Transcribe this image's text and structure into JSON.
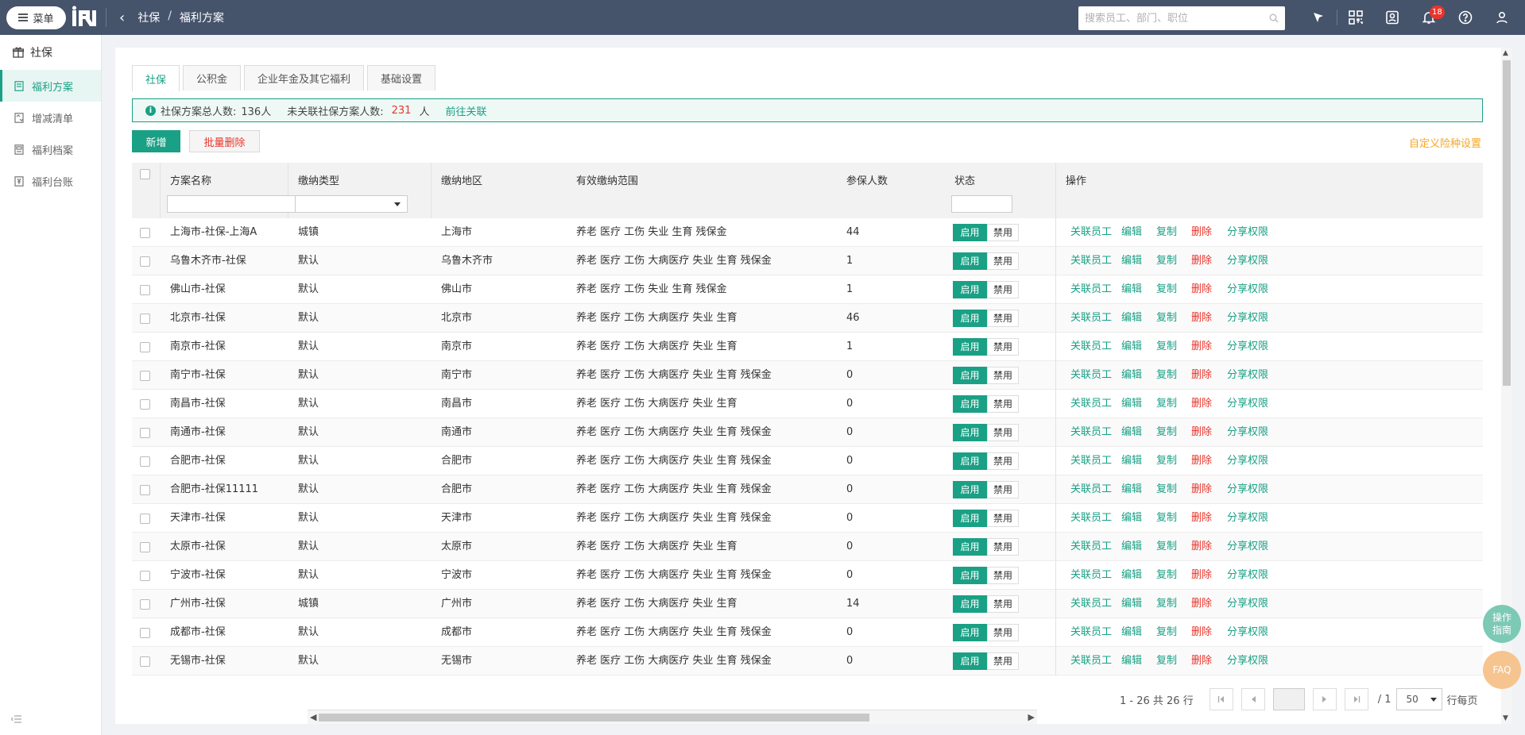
{
  "topbar": {
    "menu_label": "菜单",
    "breadcrumb": [
      "社保",
      "福利方案"
    ],
    "search_placeholder": "搜索员工、部门、职位",
    "notification_count": "18"
  },
  "sidebar": {
    "group": "社保",
    "items": [
      {
        "label": "福利方案",
        "active": true
      },
      {
        "label": "增减清单",
        "active": false
      },
      {
        "label": "福利档案",
        "active": false
      },
      {
        "label": "福利台账",
        "active": false
      }
    ]
  },
  "tabs": [
    "社保",
    "公积金",
    "企业年金及其它福利",
    "基础设置"
  ],
  "notice": {
    "total_label": "社保方案总人数:",
    "total_value": "136人",
    "unlinked_label": "未关联社保方案人数:",
    "unlinked_value": "231",
    "unlinked_unit": "人",
    "link": "前往关联"
  },
  "toolbar": {
    "add": "新增",
    "batch_delete": "批量删除",
    "custom": "自定义险种设置"
  },
  "table": {
    "headers": {
      "name": "方案名称",
      "type": "缴纳类型",
      "region": "缴纳地区",
      "scope": "有效缴纳范围",
      "count": "参保人数",
      "status": "状态",
      "ops": "操作"
    },
    "btn_on": "启用",
    "btn_off": "禁用",
    "ops": [
      "关联员工",
      "编辑",
      "复制",
      "删除",
      "分享权限"
    ],
    "rows": [
      {
        "name": "上海市-社保-上海A",
        "type": "城镇",
        "region": "上海市",
        "scope": "养老 医疗 工伤 失业 生育 残保金",
        "count": "44"
      },
      {
        "name": "乌鲁木齐市-社保",
        "type": "默认",
        "region": "乌鲁木齐市",
        "scope": "养老 医疗 工伤 大病医疗 失业 生育 残保金",
        "count": "1"
      },
      {
        "name": "佛山市-社保",
        "type": "默认",
        "region": "佛山市",
        "scope": "养老 医疗 工伤 失业 生育 残保金",
        "count": "1"
      },
      {
        "name": "北京市-社保",
        "type": "默认",
        "region": "北京市",
        "scope": "养老 医疗 工伤 大病医疗 失业 生育",
        "count": "46"
      },
      {
        "name": "南京市-社保",
        "type": "默认",
        "region": "南京市",
        "scope": "养老 医疗 工伤 大病医疗 失业 生育",
        "count": "1"
      },
      {
        "name": "南宁市-社保",
        "type": "默认",
        "region": "南宁市",
        "scope": "养老 医疗 工伤 大病医疗 失业 生育 残保金",
        "count": "0"
      },
      {
        "name": "南昌市-社保",
        "type": "默认",
        "region": "南昌市",
        "scope": "养老 医疗 工伤 大病医疗 失业 生育",
        "count": "0"
      },
      {
        "name": "南通市-社保",
        "type": "默认",
        "region": "南通市",
        "scope": "养老 医疗 工伤 大病医疗 失业 生育 残保金",
        "count": "0"
      },
      {
        "name": "合肥市-社保",
        "type": "默认",
        "region": "合肥市",
        "scope": "养老 医疗 工伤 大病医疗 失业 生育 残保金",
        "count": "0"
      },
      {
        "name": "合肥市-社保11111",
        "type": "默认",
        "region": "合肥市",
        "scope": "养老 医疗 工伤 大病医疗 失业 生育 残保金",
        "count": "0"
      },
      {
        "name": "天津市-社保",
        "type": "默认",
        "region": "天津市",
        "scope": "养老 医疗 工伤 大病医疗 失业 生育 残保金",
        "count": "0"
      },
      {
        "name": "太原市-社保",
        "type": "默认",
        "region": "太原市",
        "scope": "养老 医疗 工伤 大病医疗 失业 生育",
        "count": "0"
      },
      {
        "name": "宁波市-社保",
        "type": "默认",
        "region": "宁波市",
        "scope": "养老 医疗 工伤 大病医疗 失业 生育 残保金",
        "count": "0"
      },
      {
        "name": "广州市-社保",
        "type": "城镇",
        "region": "广州市",
        "scope": "养老 医疗 工伤 大病医疗 失业 生育",
        "count": "14"
      },
      {
        "name": "成都市-社保",
        "type": "默认",
        "region": "成都市",
        "scope": "养老 医疗 工伤 大病医疗 失业 生育 残保金",
        "count": "0"
      },
      {
        "name": "无锡市-社保",
        "type": "默认",
        "region": "无锡市",
        "scope": "养老 医疗 工伤 大病医疗 失业 生育 残保金",
        "count": "0"
      }
    ]
  },
  "pager": {
    "summary": "1 - 26 共 26 行",
    "total_pages": "/ 1",
    "page_size": "50",
    "per_page": "行每页"
  },
  "float": {
    "guide_line1": "操作",
    "guide_line2": "指南",
    "faq": "FAQ"
  }
}
